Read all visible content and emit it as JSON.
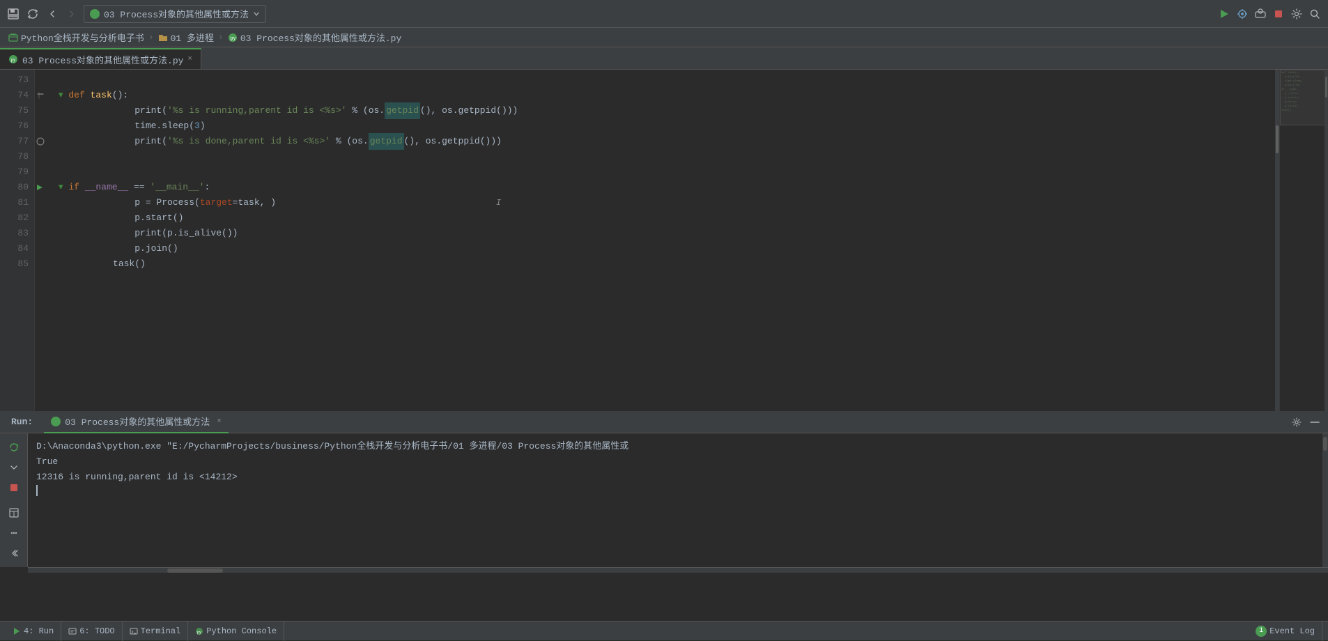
{
  "toolbar": {
    "run_config": "03 Process对象的其他属性或方法",
    "run_label": "Run:",
    "close_label": "×"
  },
  "breadcrumb": {
    "project": "Python全栈开发与分析电子书",
    "folder": "01 多进程",
    "file": "03 Process对象的其他属性或方法.py"
  },
  "tab": {
    "label": "03 Process对象的其他属性或方法.py",
    "close": "×"
  },
  "code": {
    "lines": [
      {
        "num": "73",
        "content": ""
      },
      {
        "num": "74",
        "content": "    def task():"
      },
      {
        "num": "75",
        "content": "        print('%s is running,parent id is <%s>' % (os.getpid(), os.getppid()))"
      },
      {
        "num": "76",
        "content": "        time.sleep(3)"
      },
      {
        "num": "77",
        "content": "        print('%s is done,parent id is <%s>' % (os.getpid(), os.getppid()))"
      },
      {
        "num": "78",
        "content": ""
      },
      {
        "num": "79",
        "content": ""
      },
      {
        "num": "80",
        "content": "    if __name__ == '__main__':"
      },
      {
        "num": "81",
        "content": "        p = Process(target=task, )"
      },
      {
        "num": "82",
        "content": "        p.start()"
      },
      {
        "num": "83",
        "content": "        print(p.is_alive())"
      },
      {
        "num": "84",
        "content": "        p.join()"
      },
      {
        "num": "85",
        "content": "    task()"
      }
    ]
  },
  "run_panel": {
    "label": "Run:",
    "tab_label": "03 Process对象的其他属性或方法",
    "close": "×",
    "output_lines": [
      "D:\\Anaconda3\\python.exe \"E:/PycharmProjects/business/Python全栈开发与分析电子书/01 多进程/03 Process对象的其他属性或",
      "True",
      "12316 is running,parent id is <14212>"
    ]
  },
  "status_bar": {
    "run_label": "4: Run",
    "todo_label": "6: TODO",
    "terminal_label": "Terminal",
    "python_console_label": "Python Console",
    "event_log_label": "Event Log",
    "event_log_count": "1"
  }
}
